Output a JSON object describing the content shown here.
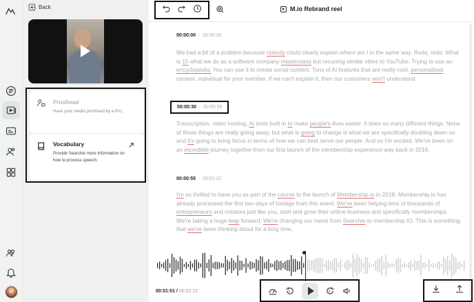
{
  "app": {
    "logo_icon": "mountain-logo-icon"
  },
  "rail": {
    "items": [
      {
        "name": "chapters-icon"
      },
      {
        "name": "media-icon",
        "active": true
      },
      {
        "name": "captions-icon"
      },
      {
        "name": "speakers-icon"
      },
      {
        "name": "apps-icon"
      },
      {
        "name": "team-icon"
      },
      {
        "name": "notifications-icon"
      }
    ]
  },
  "sidebar": {
    "back_label": "Back",
    "cards": [
      {
        "icon": "proofread-icon",
        "title": "Proofread",
        "description": "Have your media proofread by a Pro."
      },
      {
        "icon": "book-icon",
        "title": "Vocabulary",
        "description": "Provide Searchie more information on how to process speech."
      }
    ]
  },
  "header": {
    "title": "M.io Rebrand reel",
    "buttons": [
      "undo-icon",
      "redo-icon",
      "history-icon",
      "search-icon"
    ]
  },
  "transcript": [
    {
      "start": "00:00:00",
      "end": "00:00:30",
      "html": "We had a bit of a problem because <span class=\"u\">nobody</span> could clearly explain where am I in the same way. Redo, redo. What is <span class=\"u\">15</span> what we do as a software company <span class=\"u\">masterclass</span> but recurring similar vibes to YouTube. Trying to use an <span class=\"u\">encyclopedia.</span> You can use it to create social content. Tons of AI features that are really cool, <span class=\"u\">personalized</span> content, individual for your member. If we can't explain it, then our customers <span class=\"u\">won't</span> understand."
    },
    {
      "start": "00:00:30",
      "end": "00:00:55",
      "html": "Transcription, video hosting, <span class=\"u\">AI</span> tools built in <span class=\"u\">to</span> make <span class=\"u\">people's</span> lives easier. It does so many different things. None of those things are really going away, but what is <span class=\"u\">going</span> to change is what we are specifically doubling down on and <span class=\"u\">it's</span> going to bring focus in terms of how we can best serve our people. And so I'm excited. We've been on an <span class=\"u\">incredible</span> journey together from our first launch of the membership experience way back in 2016."
    },
    {
      "start": "00:00:55",
      "end": "00:01:22",
      "html": "<span class=\"u\">I'm</span> so thrilled to have you as part of the <span class=\"u\">course</span> to the launch of <span class=\"u\">Membership.io</span> in 2019. Membership.io has already processed the first two days of footage from this event. <span class=\"u\">We've</span> been helping tens of thousands of <span class=\"u\">entrepreneurs</span> and creators just like you, start and grow their online business and specifically memberships. We're taking a huge <span class=\"u\">leap</span> forward. <span class=\"u\">We're</span> changing our name from <span class=\"u\">Searchie</span> to membership IO. This is something that <span class=\"u\">we've</span> been thinking about for a long time."
    }
  ],
  "player": {
    "current_time": "00:01:01 /",
    "total_time": "00:02:12",
    "playback_fraction": 0.477,
    "controls": [
      "speed-icon",
      "rewind-icon",
      "play-icon",
      "forward-icon",
      "volume-icon"
    ],
    "export": [
      "download-icon",
      "upload-icon"
    ]
  },
  "colors": {
    "accent_underline": "#e06b6b",
    "panel_bg": "#eff1f0",
    "text_muted": "#a9a9a9"
  }
}
